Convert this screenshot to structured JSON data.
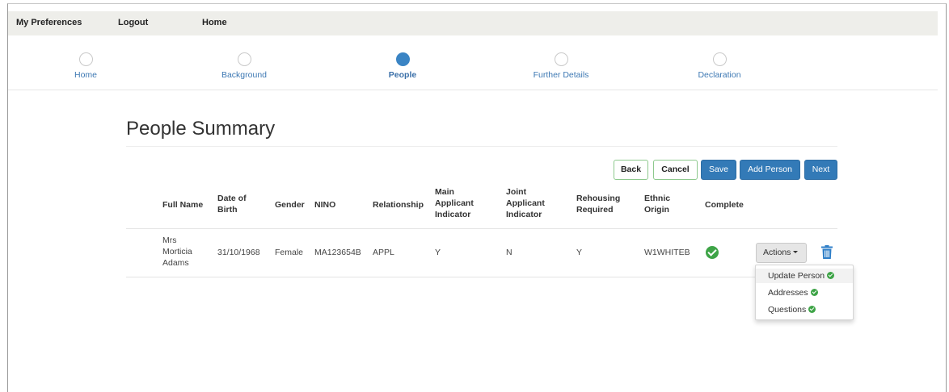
{
  "topnav": {
    "preferences": "My Preferences",
    "logout": "Logout",
    "home": "Home"
  },
  "wizard": {
    "steps": [
      {
        "label": "Home",
        "active": false
      },
      {
        "label": "Background",
        "active": false
      },
      {
        "label": "People",
        "active": true
      },
      {
        "label": "Further Details",
        "active": false
      },
      {
        "label": "Declaration",
        "active": false
      }
    ]
  },
  "page": {
    "title": "People Summary"
  },
  "buttons": {
    "back": "Back",
    "cancel": "Cancel",
    "save": "Save",
    "add_person": "Add Person",
    "next": "Next"
  },
  "table": {
    "headers": {
      "full_name": "Full Name",
      "dob_1": "Date of",
      "dob_2": "Birth",
      "gender": "Gender",
      "nino": "NINO",
      "relationship": "Relationship",
      "main_1": "Main",
      "main_2": "Applicant",
      "main_3": "Indicator",
      "joint_1": "Joint",
      "joint_2": "Applicant",
      "joint_3": "Indicator",
      "rehousing_1": "Rehousing",
      "rehousing_2": "Required",
      "ethnic_1": "Ethnic",
      "ethnic_2": "Origin",
      "complete": "Complete"
    },
    "rows": [
      {
        "name_1": "Mrs",
        "name_2": "Morticia",
        "name_3": "Adams",
        "dob": "31/10/1968",
        "gender": "Female",
        "nino": "MA123654B",
        "relationship": "APPL",
        "main_applicant": "Y",
        "joint_applicant": "N",
        "rehousing": "Y",
        "ethnic_origin": "W1WHITEB",
        "complete": true
      }
    ]
  },
  "actions": {
    "label": "Actions",
    "menu": [
      "Update Person",
      "Addresses",
      "Questions"
    ]
  },
  "colors": {
    "primary": "#337ab7",
    "success": "#3ea447",
    "link": "#3d78b3"
  },
  "icons": [
    "check-circle-icon",
    "trash-icon",
    "caret-down-icon"
  ]
}
